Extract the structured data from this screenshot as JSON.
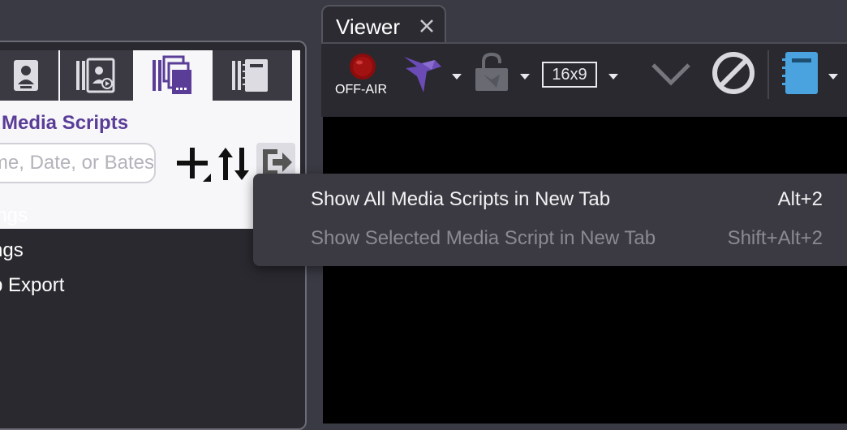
{
  "left_panel": {
    "title": "Media Scripts",
    "search": {
      "placeholder": "Name, Date, or Bates",
      "value": ""
    },
    "tabs": [
      {
        "icon": "person-card-icon",
        "active": false
      },
      {
        "icon": "video-card-icon",
        "active": false
      },
      {
        "icon": "media-scripts-icon",
        "active": true
      },
      {
        "icon": "notebook-icon",
        "active": false
      }
    ],
    "list_items": [
      "ings",
      "ngs",
      "p Export"
    ]
  },
  "viewer": {
    "tab_label": "Viewer",
    "offair_label": "OFF-AIR",
    "aspect_label": "16x9",
    "colors": {
      "accent_purple": "#6b4bb5",
      "offair_red": "#8a0c0c",
      "notebook_blue": "#4aa3df"
    }
  },
  "context_menu": {
    "items": [
      {
        "label": "Show All Media Scripts in New Tab",
        "shortcut": "Alt+2",
        "enabled": true
      },
      {
        "label": "Show Selected Media Script in New Tab",
        "shortcut": "Shift+Alt+2",
        "enabled": false
      }
    ]
  }
}
